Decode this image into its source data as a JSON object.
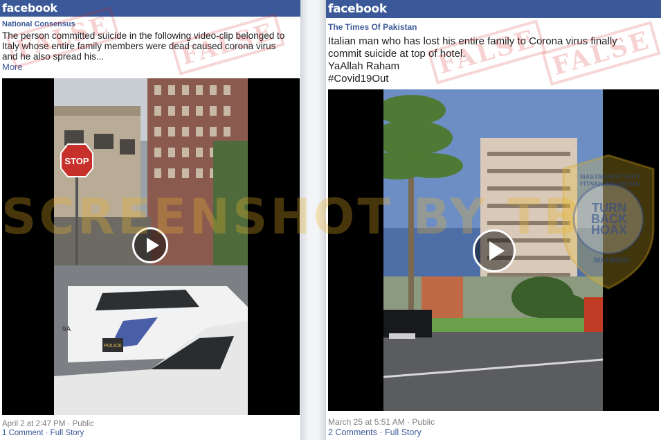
{
  "left": {
    "brand": "facebook",
    "page_name": "National Consensus",
    "message_lines": [
      "The person committed suicide in the following video-clip belonged to",
      "Italy whose entire family members were dead caused corona virus",
      "and he also spread his..."
    ],
    "more_label": "More",
    "stamp_text": "FALSE",
    "timestamp": "April 2 at 2:47 PM · Public",
    "comments_label": "1 Comment",
    "full_story_label": "Full Story",
    "video_signs": {
      "stop": "STOP",
      "police": "POLICE",
      "car_code": "9A"
    }
  },
  "right": {
    "brand": "facebook",
    "page_name": "The Times Of Pakistan",
    "message_lines": [
      "Italian man who has lost his entire family to Corona virus finally",
      "commit suicide at top of hotel.",
      "YaAllah Raham",
      "#Covid19Out"
    ],
    "stamp_text": "FALSE",
    "timestamp": "March 25 at 5:51 AM · Public",
    "comments_label": "2 Comments",
    "full_story_label": "Full Story"
  },
  "overlay": {
    "watermark": "SCREENSHOT BY TB",
    "badge_center": "TURN\nBACK\nHOAX",
    "badge_arc_top": "MASYARAKAT ANTI FITNAH INDONESIA",
    "badge_arc_bottom": "MAFINDO"
  }
}
